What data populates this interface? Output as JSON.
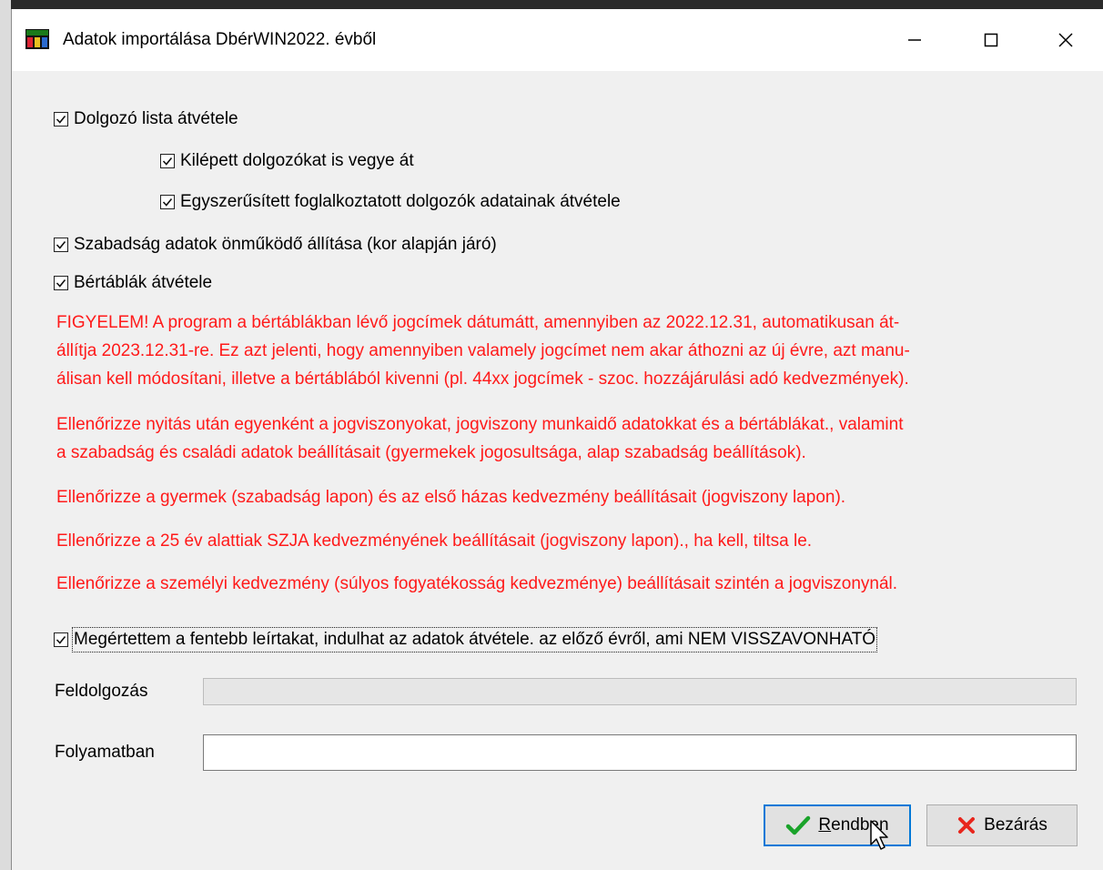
{
  "window": {
    "title": "Adatok importálása DbérWIN2022. évből",
    "minimize_icon": "minimize-icon",
    "maximize_icon": "maximize-icon",
    "close_icon": "close-icon"
  },
  "options": {
    "employee_list": {
      "label": "Dolgozó lista átvétele",
      "checked": true
    },
    "departed_employees": {
      "label": "Kilépett dolgozókat is vegye át",
      "checked": true
    },
    "simplified_employees": {
      "label": "Egyszerűsített foglalkoztatott dolgozók adatainak átvétele",
      "checked": true
    },
    "leave_auto": {
      "label": "Szabadság adatok önműködő állítása (kor alapján járó)",
      "checked": true
    },
    "wage_tables": {
      "label": "Bértáblák átvétele",
      "checked": true
    }
  },
  "warnings": {
    "w1_line1": "FIGYELEM! A program a bértáblákban lévő jogcímek dátumátt, amennyiben az 2022.12.31, automatikusan át-",
    "w1_line2": "állítja 2023.12.31-re. Ez azt jelenti, hogy amennyiben valamely jogcímet nem akar áthozni az új évre, azt manu-",
    "w1_line3": "álisan kell módosítani, illetve a bértáblából kivenni (pl. 44xx jogcímek  - szoc. hozzájárulási adó kedvezmények).",
    "w2_line1": "Ellenőrizze nyitás után egyenként a jogviszonyokat, jogviszony munkaidő adatokkat és a bértáblákat., valamint",
    "w2_line2": "a szabadság és családi adatok beállításait (gyermekek jogosultsága, alap szabadság beállítások).",
    "w3": "Ellenőrizze a gyermek (szabadság lapon) és az első házas kedvezmény beállításait (jogviszony lapon).",
    "w4": "Ellenőrizze a 25 év alattiak SZJA kedvezményének beállításait (jogviszony lapon)., ha kell, tiltsa le.",
    "w5": "Ellenőrizze a személyi kedvezmény (súlyos fogyatékosság kedvezménye) beállításait szintén a jogviszonynál.",
    "color": "#ff1a1a"
  },
  "confirm": {
    "label": "Megértettem a fentebb leírtakat, indulhat az adatok átvétele. az előző évről, ami NEM VISSZAVONHATÓ",
    "checked": true
  },
  "processing": {
    "label": "Feldolgozás",
    "progress": 0
  },
  "in_progress": {
    "label": "Folyamatban",
    "value": ""
  },
  "buttons": {
    "ok_prefix": "R",
    "ok_rest": "endben",
    "ok_icon": "checkmark-icon",
    "close_label": "Bezárás",
    "close_icon": "x-icon"
  },
  "colors": {
    "check_green": "#1aa32a",
    "close_red": "#e8261d",
    "focus_blue": "#0078d7"
  }
}
